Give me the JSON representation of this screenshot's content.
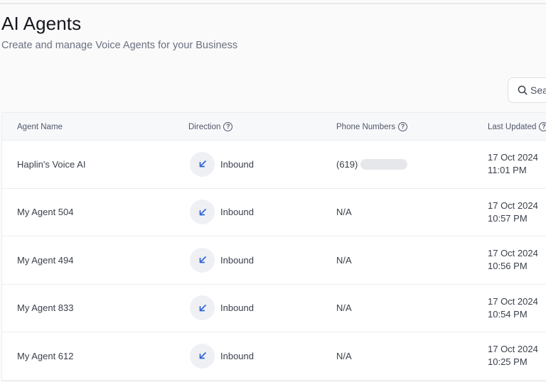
{
  "header": {
    "title": "AI Agents",
    "subtitle": "Create and manage Voice Agents for your Business"
  },
  "search": {
    "placeholder": "Sear",
    "icon": "search-icon"
  },
  "table": {
    "columns": {
      "name": "Agent Name",
      "direction": "Direction",
      "phone": "Phone Numbers",
      "updated": "Last Updated"
    },
    "help_icon": "?",
    "rows": [
      {
        "name": "Haplin's Voice AI",
        "direction": "Inbound",
        "phone": "(619)",
        "phone_redacted": true,
        "date": "17 Oct 2024",
        "time": "11:01 PM"
      },
      {
        "name": "My Agent 504",
        "direction": "Inbound",
        "phone": "N/A",
        "phone_redacted": false,
        "date": "17 Oct 2024",
        "time": "10:57 PM"
      },
      {
        "name": "My Agent 494",
        "direction": "Inbound",
        "phone": "N/A",
        "phone_redacted": false,
        "date": "17 Oct 2024",
        "time": "10:56 PM"
      },
      {
        "name": "My Agent 833",
        "direction": "Inbound",
        "phone": "N/A",
        "phone_redacted": false,
        "date": "17 Oct 2024",
        "time": "10:54 PM"
      },
      {
        "name": "My Agent 612",
        "direction": "Inbound",
        "phone": "N/A",
        "phone_redacted": false,
        "date": "17 Oct 2024",
        "time": "10:25 PM"
      }
    ]
  },
  "colors": {
    "accent": "#2f63d6",
    "icon_bg": "#eef0f4"
  }
}
